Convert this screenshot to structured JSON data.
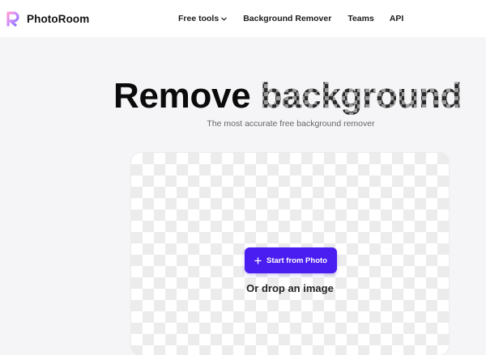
{
  "header": {
    "logo_text": "PhotoRoom",
    "nav": [
      {
        "label": "Free tools",
        "icon": "chevron-down-icon"
      },
      {
        "label": "Background Remover"
      },
      {
        "label": "Teams"
      },
      {
        "label": "API"
      }
    ]
  },
  "hero": {
    "title_plain": "Remove",
    "title_pattern": "background",
    "subtitle": "The most accurate free background remover"
  },
  "upload": {
    "button_icon": "plus-icon",
    "button_label": "Start from Photo",
    "drop_hint": "Or drop an image"
  },
  "colors": {
    "accent": "#4a1df0",
    "page_bg": "#f5f5f7"
  }
}
